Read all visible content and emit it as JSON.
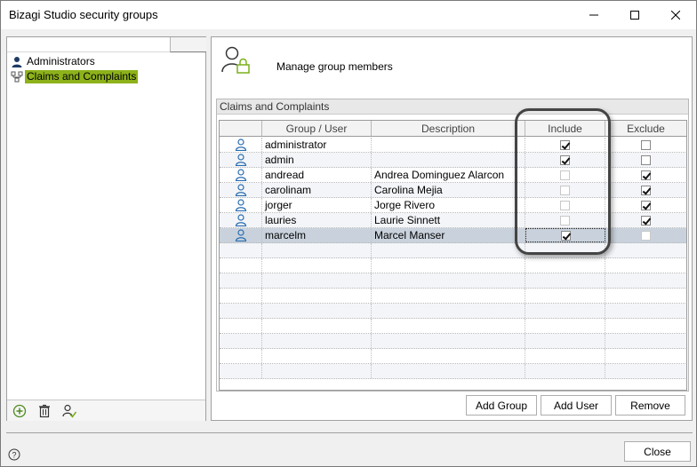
{
  "window": {
    "title": "Bizagi Studio security groups"
  },
  "tree": {
    "items": [
      {
        "label": "Administrators",
        "icon": "user-icon",
        "selected": false
      },
      {
        "label": "Claims and Complaints",
        "icon": "group-icon",
        "selected": true
      }
    ]
  },
  "left_footer": {
    "icons": [
      "add-icon",
      "trash-icon",
      "user-check-icon"
    ]
  },
  "main": {
    "header_label": "Manage group members",
    "group_title": "Claims and Complaints",
    "columns": [
      "Group / User",
      "Description",
      "Include",
      "Exclude"
    ],
    "rows": [
      {
        "user": "administrator",
        "description": "",
        "include": true,
        "include_enabled": true,
        "exclude": false,
        "exclude_enabled": true
      },
      {
        "user": "admin",
        "description": "",
        "include": true,
        "include_enabled": true,
        "exclude": false,
        "exclude_enabled": true
      },
      {
        "user": "andread",
        "description": "Andrea Dominguez Alarcon",
        "include": false,
        "include_enabled": false,
        "exclude": true,
        "exclude_enabled": true
      },
      {
        "user": "carolinam",
        "description": "Carolina Mejia",
        "include": false,
        "include_enabled": false,
        "exclude": true,
        "exclude_enabled": true
      },
      {
        "user": "jorger",
        "description": "Jorge Rivero",
        "include": false,
        "include_enabled": false,
        "exclude": true,
        "exclude_enabled": true
      },
      {
        "user": "lauries",
        "description": "Laurie Sinnett",
        "include": false,
        "include_enabled": false,
        "exclude": true,
        "exclude_enabled": true
      },
      {
        "user": "marcelm",
        "description": "Marcel Manser",
        "include": true,
        "include_enabled": true,
        "exclude": false,
        "exclude_enabled": false,
        "selected": true
      }
    ],
    "buttons": {
      "add_group": "Add Group",
      "add_user": "Add User",
      "remove": "Remove"
    }
  },
  "footer": {
    "close": "Close"
  },
  "colors": {
    "selection_green": "#8db21a",
    "row_selected": "#c9d2dc",
    "user_icon_blue": "#2a6db0"
  }
}
